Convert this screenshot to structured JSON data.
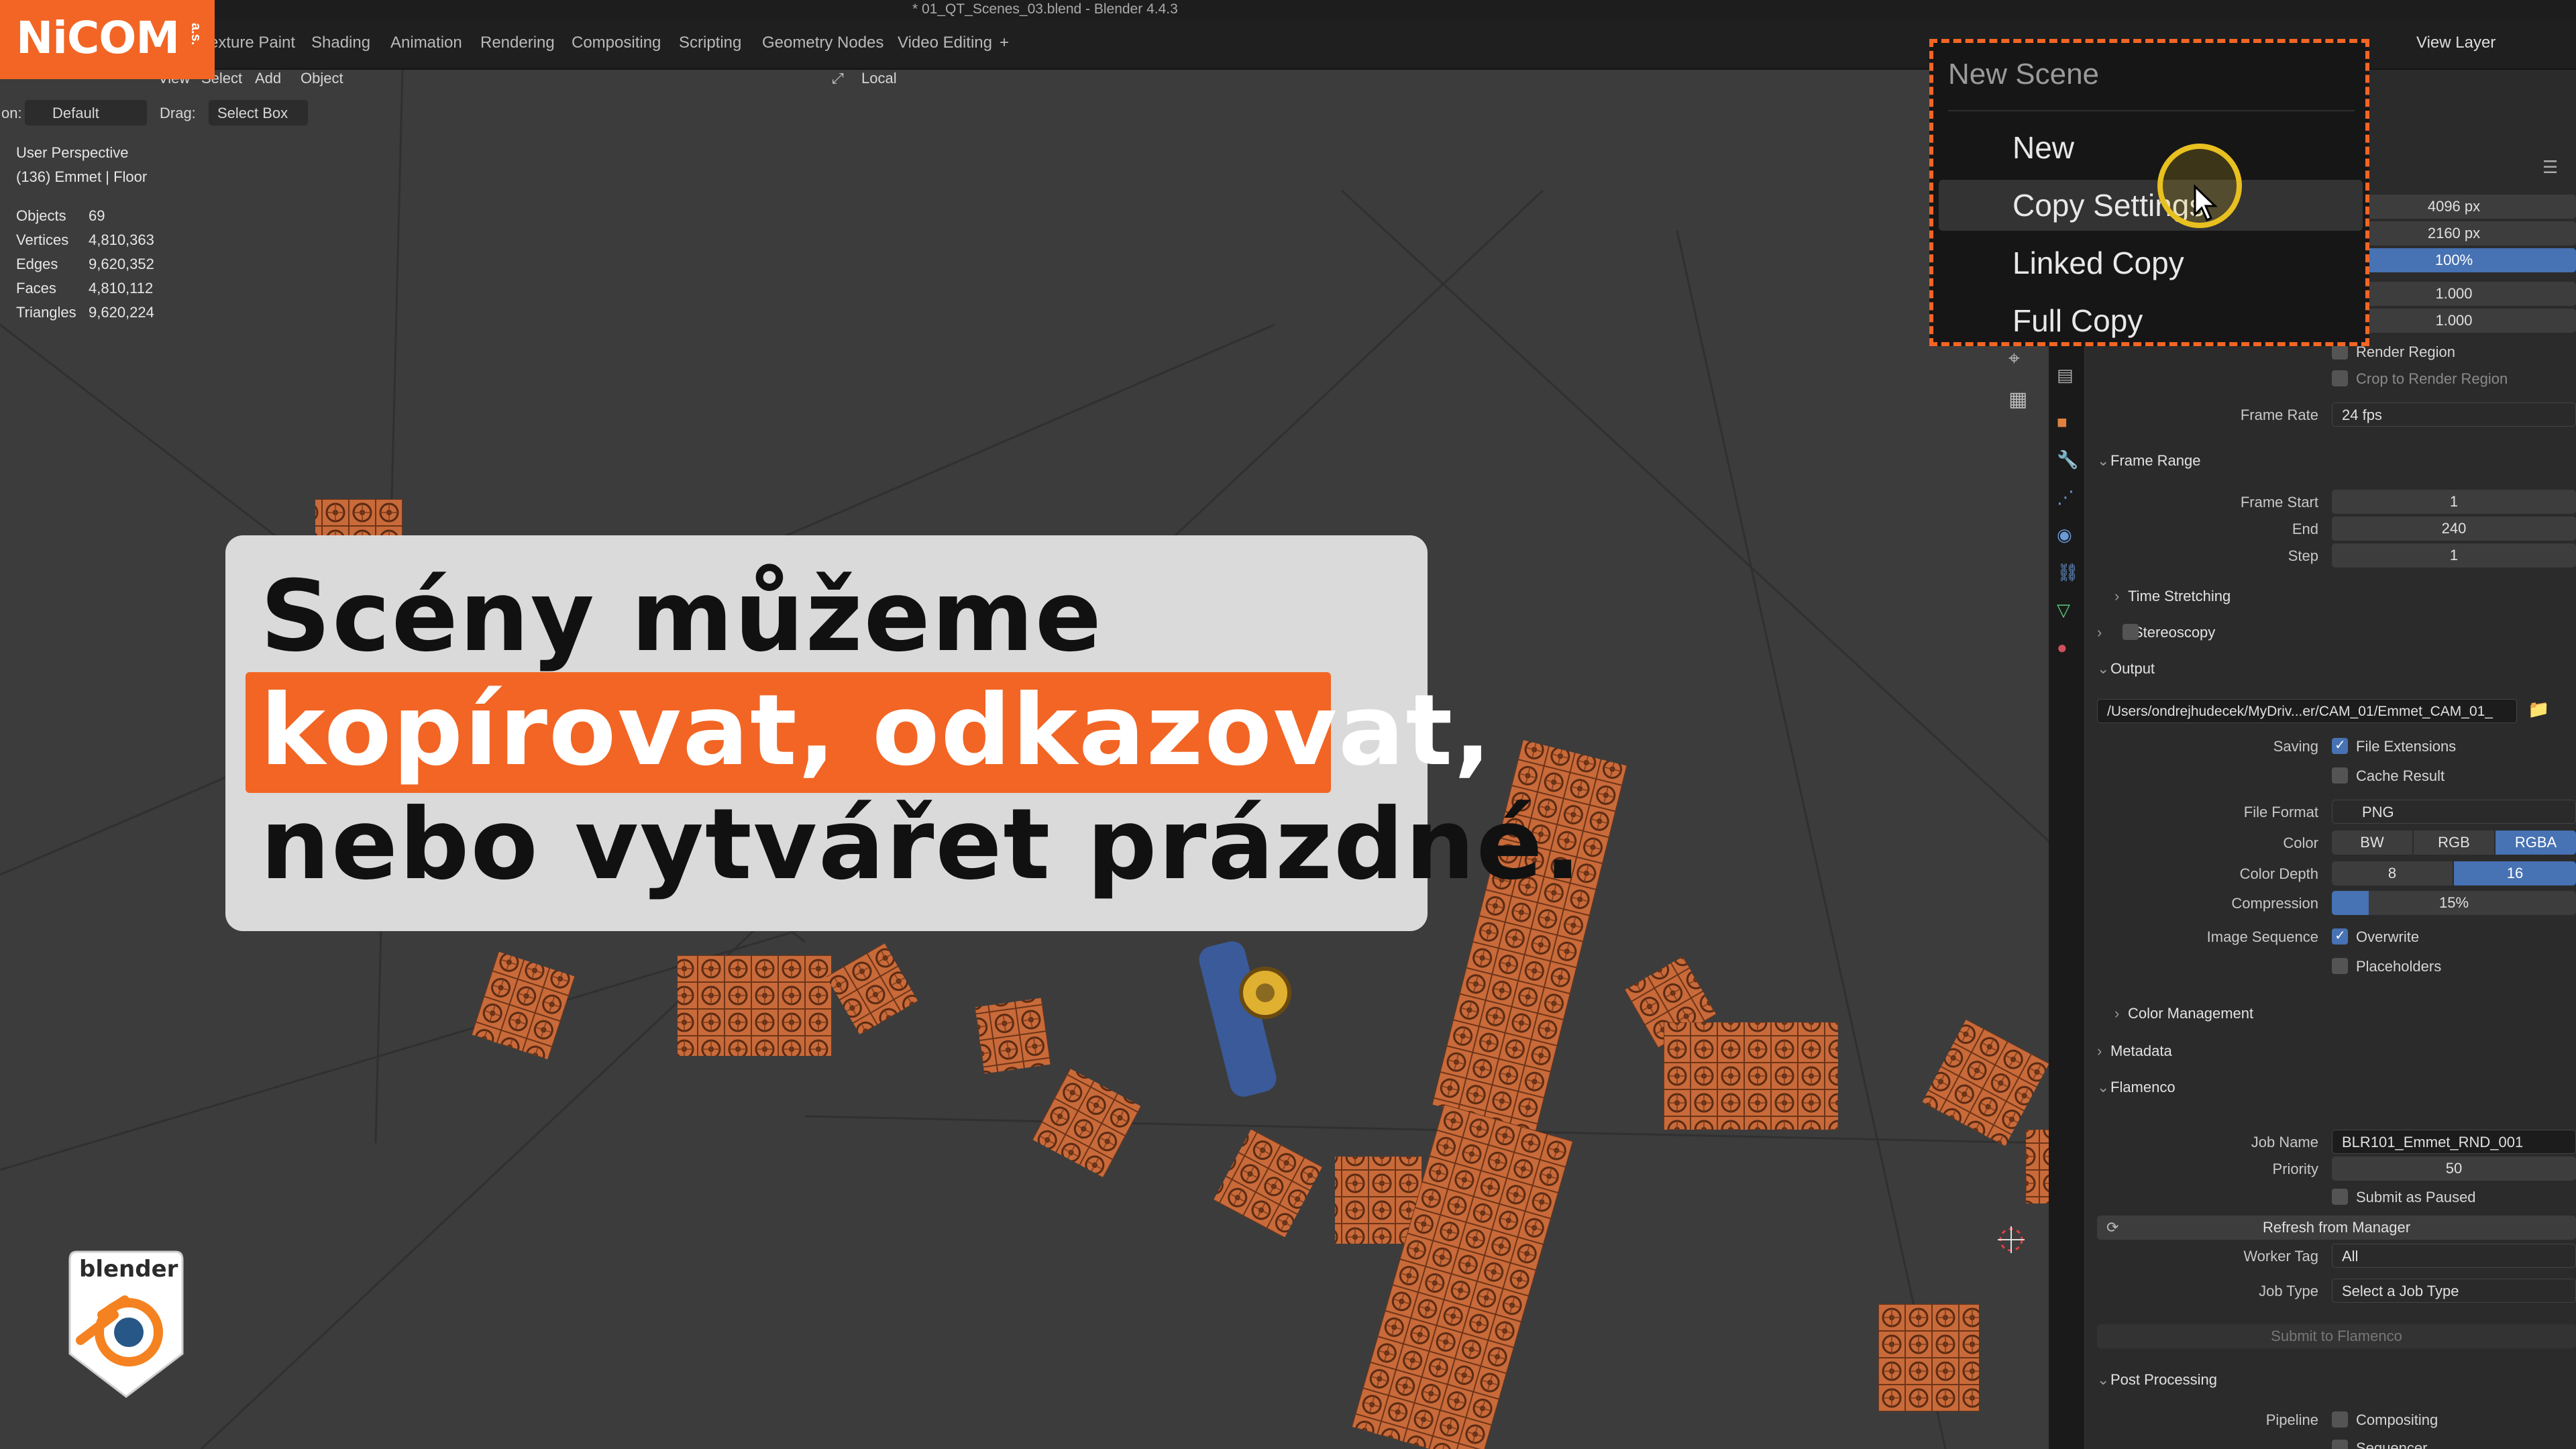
{
  "window": {
    "title": "* 01_QT_Scenes_03.blend - Blender 4.4.3"
  },
  "workspaces": [
    "Texture Paint",
    "Shading",
    "Animation",
    "Rendering",
    "Compositing",
    "Scripting",
    "Geometry Nodes",
    "Video Editing",
    "+"
  ],
  "header_right": {
    "view_layer": "View Layer"
  },
  "viewport_header": {
    "menus": [
      "View",
      "Select",
      "Add",
      "Object"
    ],
    "orientation_label": "on:",
    "orientation_value": "Default",
    "drag_label": "Drag:",
    "drag_value": "Select Box",
    "pivot": "Local"
  },
  "viewport_info": {
    "perspective": "User Perspective",
    "context": "(136) Emmet | Floor",
    "stats": [
      {
        "label": "Objects",
        "value": "69"
      },
      {
        "label": "Vertices",
        "value": "4,810,363"
      },
      {
        "label": "Edges",
        "value": "9,620,352"
      },
      {
        "label": "Faces",
        "value": "4,810,112"
      },
      {
        "label": "Triangles",
        "value": "9,620,224"
      }
    ]
  },
  "new_scene_menu": {
    "title": "New Scene",
    "items": [
      "New",
      "Copy Settings",
      "Linked Copy",
      "Full Copy"
    ],
    "hovered": "Copy Settings"
  },
  "properties": {
    "resolution_x": "4096 px",
    "resolution_y": "2160 px",
    "resolution_pct": "100%",
    "aspect_x": "1.000",
    "aspect_y": "1.000",
    "render_region": "Render Region",
    "crop_region": "Crop to Render Region",
    "frame_rate_label": "Frame Rate",
    "frame_rate": "24 fps",
    "frame_range": {
      "title": "Frame Range",
      "start_label": "Frame Start",
      "start": "1",
      "end_label": "End",
      "end": "240",
      "step_label": "Step",
      "step": "1"
    },
    "time_stretching": "Time Stretching",
    "stereoscopy": "Stereoscopy",
    "output": {
      "title": "Output",
      "path": "/Users/ondrejhudecek/MyDriv...er/CAM_01/Emmet_CAM_01_",
      "saving_label": "Saving",
      "file_extensions": "File Extensions",
      "cache_result": "Cache Result",
      "file_format_label": "File Format",
      "file_format": "PNG",
      "color_label": "Color",
      "color_options": [
        "BW",
        "RGB",
        "RGBA"
      ],
      "color_selected": "RGBA",
      "depth_label": "Color Depth",
      "depth_options": [
        "8",
        "16"
      ],
      "depth_selected": "16",
      "compression_label": "Compression",
      "compression": "15%",
      "compression_fraction": 0.15,
      "sequence_label": "Image Sequence",
      "overwrite": "Overwrite",
      "placeholders": "Placeholders"
    },
    "color_management": "Color Management",
    "metadata": "Metadata",
    "flamenco": {
      "title": "Flamenco",
      "job_name_label": "Job Name",
      "job_name": "BLR101_Emmet_RND_001",
      "priority_label": "Priority",
      "priority": "50",
      "submit_paused": "Submit as Paused",
      "refresh": "Refresh from Manager",
      "worker_tag_label": "Worker Tag",
      "worker_tag": "All",
      "job_type_label": "Job Type",
      "job_type": "Select a Job Type",
      "submit": "Submit to Flamenco"
    },
    "post_processing": {
      "title": "Post Processing",
      "pipeline_label": "Pipeline",
      "compositing": "Compositing",
      "sequencer": "Sequencer"
    }
  },
  "overlay": {
    "brand": "NiCOM",
    "brand_suffix": "a.s.",
    "caption_line1": "Scény můžeme",
    "caption_line2": "kopírovat, odkazovat,",
    "caption_line3": "nebo vytvářet prázdné.",
    "blender_badge": "blender",
    "accent": "#f26524"
  }
}
